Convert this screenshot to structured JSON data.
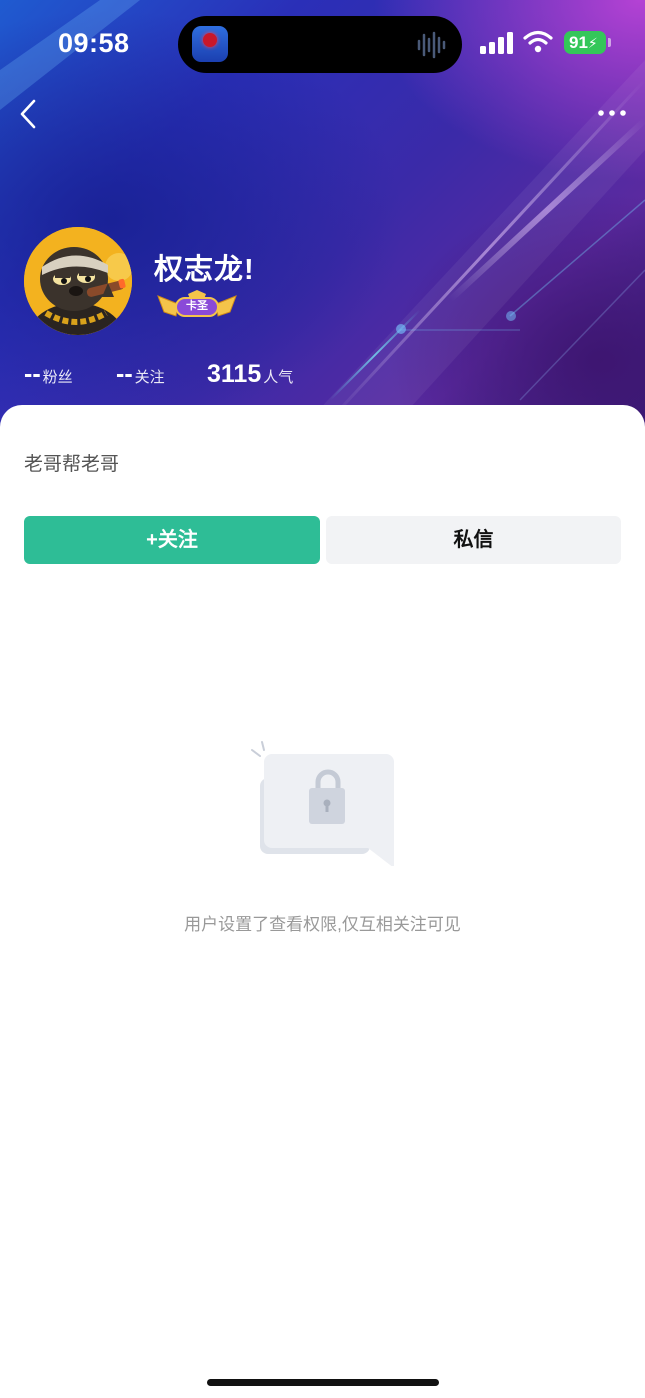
{
  "status_bar": {
    "time": "09:58",
    "battery": "91",
    "icons": [
      "app-recording-icon",
      "audio-wave-icon",
      "cellular-signal-icon",
      "wifi-icon",
      "battery-charging-icon"
    ]
  },
  "nav": {
    "back_icon": "chevron-left-icon",
    "more_icon": "more-dots-icon"
  },
  "profile": {
    "nickname": "权志龙!",
    "badge_label": "卡圣",
    "stats": [
      {
        "value": "--",
        "label": "粉丝"
      },
      {
        "value": "--",
        "label": "关注"
      },
      {
        "value": "3115",
        "label": "人气"
      }
    ]
  },
  "bio": "老哥帮老哥",
  "actions": {
    "follow_label": "+关注",
    "message_label": "私信"
  },
  "privacy_notice": "用户设置了查看权限,仅互相关注可见",
  "colors": {
    "accent_green": "#2ebd96",
    "battery_green": "#34c759",
    "secondary_button": "#f2f3f5"
  }
}
